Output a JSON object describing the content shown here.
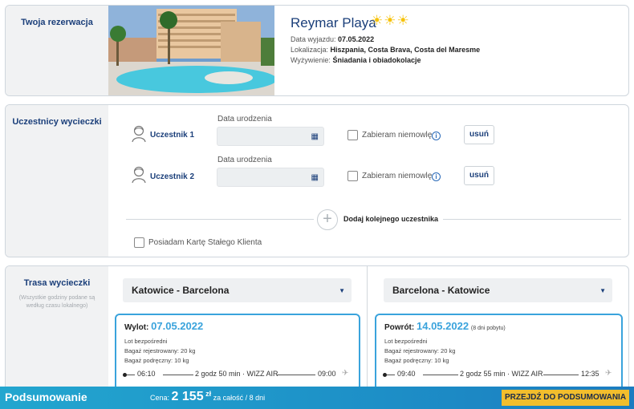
{
  "reservation": {
    "side_title": "Twoja rezerwacja",
    "hotel_name": "Reymar Playa",
    "stars": "☀☀☀",
    "date_label": "Data wyjazdu:",
    "date_value": "07.05.2022",
    "location_label": "Lokalizacja:",
    "location_value": "Hiszpania, Costa Brava, Costa del Maresme",
    "board_label": "Wyżywienie:",
    "board_value": "Śniadania i obiadokolacje"
  },
  "participants": {
    "side_title": "Uczestnicy wycieczki",
    "items": [
      {
        "name": "Uczestnik 1",
        "dob_label": "Data urodzenia",
        "infant_label": "Zabieram niemowlę",
        "remove_label": "usuń"
      },
      {
        "name": "Uczestnik 2",
        "dob_label": "Data urodzenia",
        "infant_label": "Zabieram niemowlę",
        "remove_label": "usuń"
      }
    ],
    "add_label": "Dodaj kolejnego uczestnika",
    "card_label": "Posiadam Kartę Stałego Klienta"
  },
  "route": {
    "side_title": "Trasa wycieczki",
    "side_note": "(Wszystkie godziny podane są według czasu lokalnego)",
    "outbound": {
      "select": "Katowice - Barcelona",
      "head_label": "Wylot:",
      "date": "07.05.2022",
      "line1": "Lot bezpośredni",
      "line2": "Bagaż rejestrowany: 20 kg",
      "line3": "Bagaż podręczny: 10 kg",
      "dep": "06:10",
      "duration": "2 godz 50 min · WIZZ AIR",
      "arr": "09:00"
    },
    "return": {
      "select": "Barcelona - Katowice",
      "head_label": "Powrót:",
      "date": "14.05.2022",
      "nights": "(8 dni pobytu)",
      "line1": "Lot bezpośredni",
      "line2": "Bagaż rejestrowany: 20 kg",
      "line3": "Bagaż podręczny: 10 kg",
      "dep": "09:40",
      "duration": "2 godz 55 min · WIZZ AIR",
      "arr": "12:35"
    }
  },
  "summary": {
    "title": "Podsumowanie",
    "price_label": "Cena:",
    "price_value": "2 155",
    "currency": "zł",
    "price_suffix": "za całość / 8 dni",
    "button": "PRZEJDŹ DO PODSUMOWANIA"
  },
  "colors": {
    "brand": "#1b3f7a",
    "accent": "#3aa3dc",
    "cta": "#f2be2d"
  }
}
